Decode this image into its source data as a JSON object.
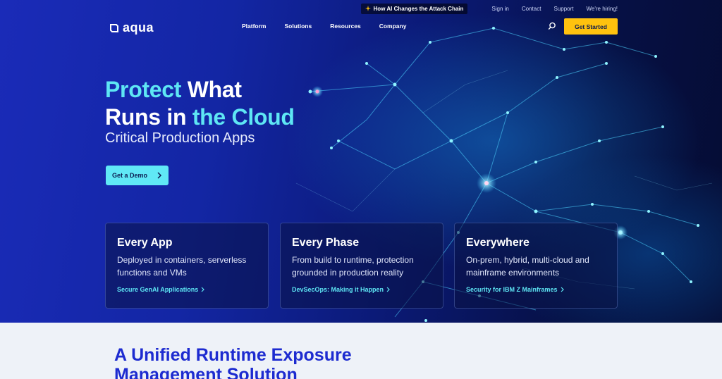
{
  "utility": {
    "promo": "How AI Changes the Attack Chain",
    "links": [
      "Sign in",
      "Contact",
      "Support",
      "We're hiring!"
    ]
  },
  "brand": {
    "name": "aqua"
  },
  "nav": {
    "items": [
      "Platform",
      "Solutions",
      "Resources",
      "Company"
    ],
    "cta": "Get Started"
  },
  "hero": {
    "line1_accent": "Protect",
    "line1_rest": " What",
    "line2_start": "Runs in ",
    "line2_accent": "the Cloud",
    "subtitle": "Critical Production Apps",
    "demo_button": "Get a Demo"
  },
  "cards": [
    {
      "title": "Every App",
      "text": "Deployed in containers, serverless functions and VMs",
      "link": "Secure GenAI Applications"
    },
    {
      "title": "Every Phase",
      "text": "From build to runtime, protection grounded in production reality",
      "link": "DevSecOps: Making it Happen"
    },
    {
      "title": "Everywhere",
      "text": "On-prem, hybrid, multi-cloud and mainframe environments",
      "link": "Security for IBM Z Mainframes"
    }
  ],
  "section": {
    "title": "A Unified Runtime Exposure Management Solution"
  },
  "colors": {
    "accent_cyan": "#5ee6f4",
    "cta_yellow": "#ffc20e",
    "heading_blue": "#1d2bd0"
  }
}
